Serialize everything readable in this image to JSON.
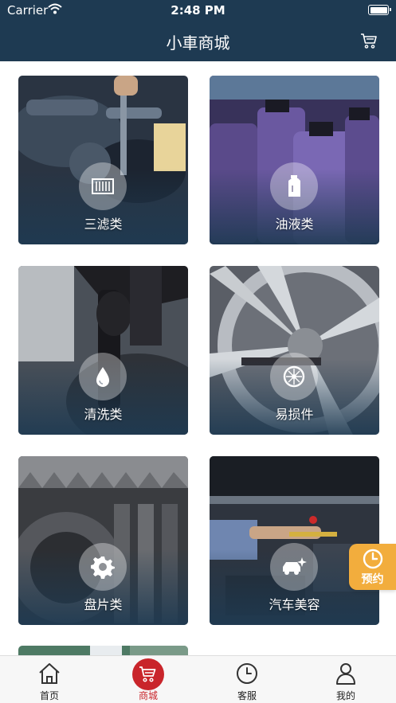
{
  "status_bar": {
    "carrier": "Carrier",
    "time": "2:48 PM"
  },
  "header": {
    "title": "小車商城"
  },
  "categories": [
    {
      "label": "三滤类",
      "icon": "filter-icon"
    },
    {
      "label": "油液类",
      "icon": "oil-bottle-icon"
    },
    {
      "label": "清洗类",
      "icon": "water-drop-icon"
    },
    {
      "label": "易损件",
      "icon": "wheel-icon"
    },
    {
      "label": "盘片类",
      "icon": "gear-icon"
    },
    {
      "label": "汽车美容",
      "icon": "car-sparkle-icon"
    }
  ],
  "reserve_button": {
    "label": "预约"
  },
  "tabbar": {
    "items": [
      {
        "label": "首页",
        "icon": "home-icon"
      },
      {
        "label": "商城",
        "icon": "cart-icon",
        "active": true
      },
      {
        "label": "客服",
        "icon": "clock-icon"
      },
      {
        "label": "我的",
        "icon": "user-icon"
      }
    ]
  },
  "colors": {
    "header_bg": "#1e3a52",
    "accent_red": "#c9252b",
    "reserve_orange": "#f2ad3d"
  }
}
